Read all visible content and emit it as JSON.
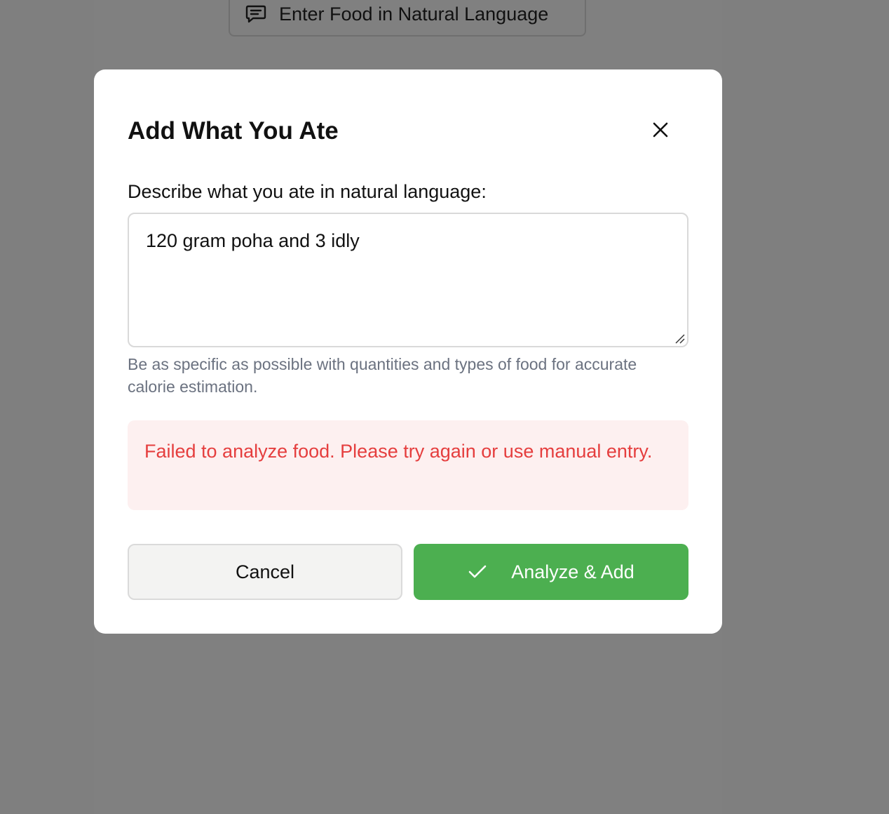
{
  "background": {
    "enter_food_button_label": "Enter Food in Natural Language",
    "overlay_color": "#7f7f7f"
  },
  "modal": {
    "title": "Add What You Ate",
    "close_icon": "close-icon",
    "field_label": "Describe what you ate in natural language:",
    "input_value": "120 gram poha and 3 idly",
    "hint": "Be as specific as possible with quantities and types of food for accurate calorie estimation.",
    "error_message": "Failed to analyze food. Please try again or use manual entry.",
    "cancel_label": "Cancel",
    "submit_label": "Analyze & Add",
    "submit_icon": "check-icon"
  },
  "colors": {
    "primary": "#4caf50",
    "error_text": "#e53e3e",
    "error_bg": "#fdf0f0",
    "hint_text": "#6b7280"
  }
}
